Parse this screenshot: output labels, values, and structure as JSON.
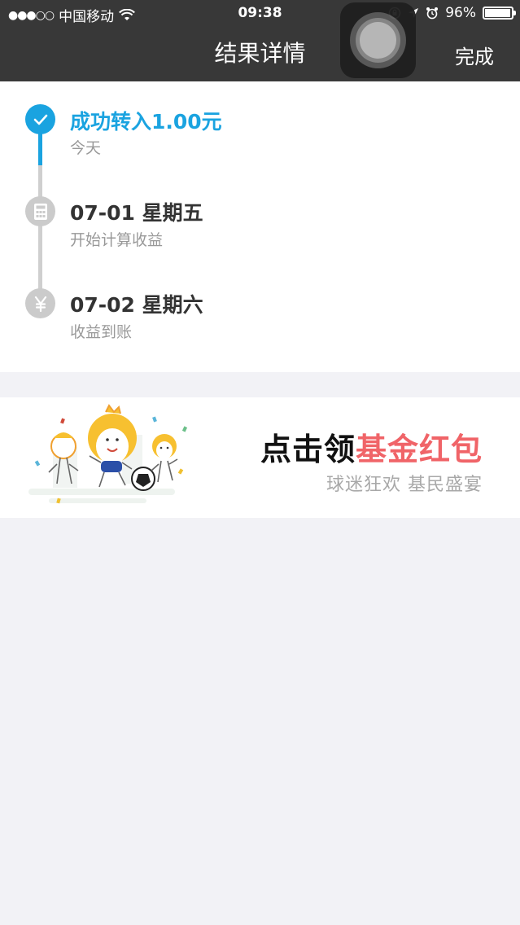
{
  "status_bar": {
    "signal": "●●●○○",
    "carrier": "中国移动",
    "time": "09:38",
    "battery_percent": "96%",
    "battery_level": 0.96
  },
  "nav": {
    "title": "结果详情",
    "done_label": "完成"
  },
  "timeline": [
    {
      "title": "成功转入1.00元",
      "subtitle": "今天",
      "state": "done",
      "icon": "check-icon"
    },
    {
      "title": "07-01 星期五",
      "subtitle": "开始计算收益",
      "state": "pending",
      "icon": "calculator-icon"
    },
    {
      "title": "07-02 星期六",
      "subtitle": "收益到账",
      "state": "pending",
      "icon": "yen-icon"
    }
  ],
  "banner": {
    "title_prefix": "点击领",
    "title_highlight": "基金红包",
    "subtitle": "球迷狂欢 基民盛宴"
  },
  "colors": {
    "accent": "#1aa3e0",
    "highlight": "#f06468",
    "navbar": "#383838"
  }
}
